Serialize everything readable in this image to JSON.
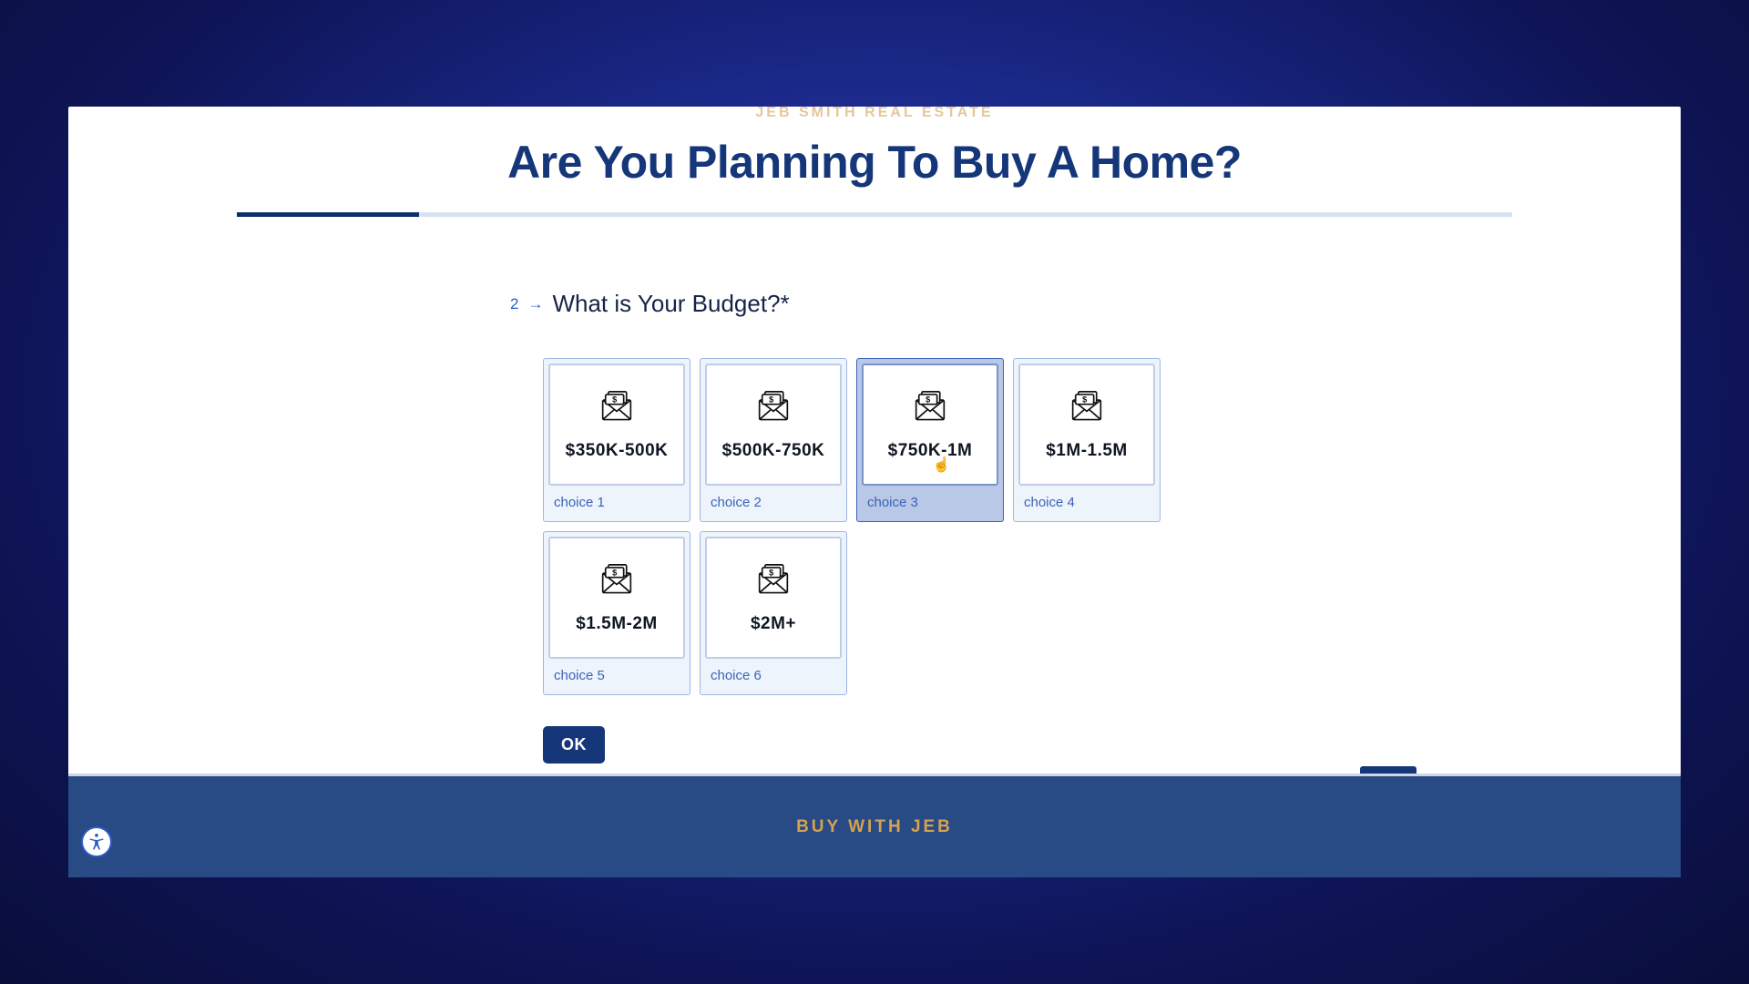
{
  "brand_top": "JEB SMITH REAL ESTATE",
  "main_title": "Are You Planning To Buy A Home?",
  "question": {
    "number": "2",
    "arrow": "→",
    "text": "What is Your Budget?*"
  },
  "choices": [
    {
      "amount": "$350K-500K",
      "label": "choice 1",
      "selected": false
    },
    {
      "amount": "$500K-750K",
      "label": "choice 2",
      "selected": false
    },
    {
      "amount": "$750K-1M",
      "label": "choice 3",
      "selected": true
    },
    {
      "amount": "$1M-1.5M",
      "label": "choice 4",
      "selected": false
    },
    {
      "amount": "$1.5M-2M",
      "label": "choice 5",
      "selected": false
    },
    {
      "amount": "$2M+",
      "label": "choice 6",
      "selected": false
    }
  ],
  "ok_button": "OK",
  "footer": "BUY WITH JEB"
}
